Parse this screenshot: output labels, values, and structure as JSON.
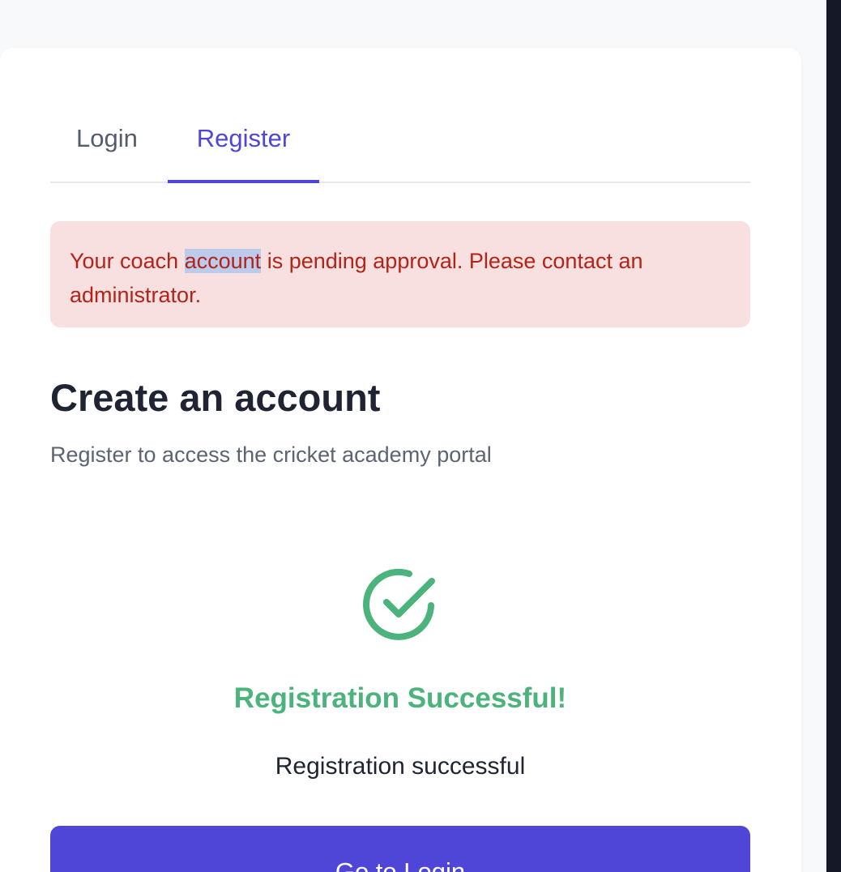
{
  "tabs": {
    "login_label": "Login",
    "register_label": "Register",
    "active": "Register"
  },
  "alert": {
    "text_before": "Your coach ",
    "highlighted": "account",
    "text_after": " is pending approval. Please contact an administrator."
  },
  "form": {
    "title": "Create an account",
    "subtitle": "Register to access the cricket academy portal"
  },
  "success": {
    "icon": "check-circle-icon",
    "title": "Registration Successful!",
    "message": "Registration successful",
    "button_label": "Go to Login"
  },
  "colors": {
    "accent": "#4f46d8",
    "success": "#4bb37b",
    "alert_bg": "#f9e0e0",
    "alert_text": "#b42318"
  }
}
